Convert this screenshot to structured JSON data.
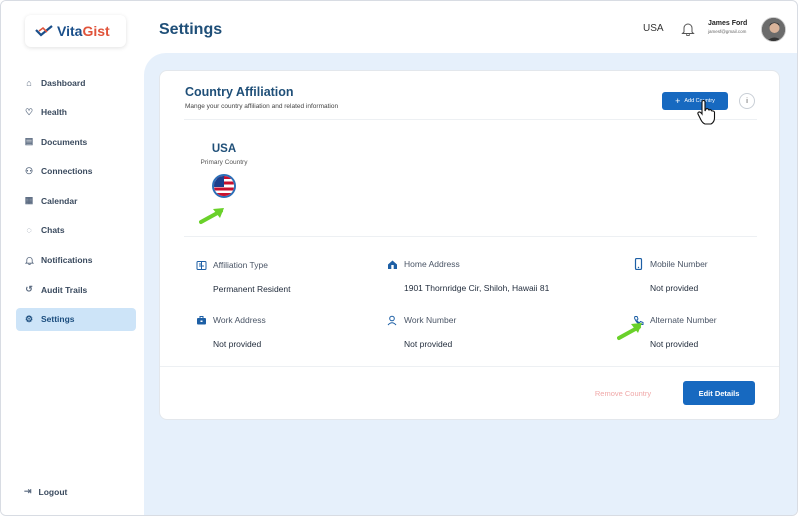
{
  "brand": {
    "name_part1": "Vita",
    "name_part2": "Gist"
  },
  "header": {
    "title": "Settings",
    "country": "USA",
    "user_name": "James Ford",
    "user_email": "jamesf@gmail.com"
  },
  "sidebar": {
    "items": [
      {
        "label": "Dashboard",
        "icon": "home-icon",
        "glyph": "⌂"
      },
      {
        "label": "Health",
        "icon": "heart-icon",
        "glyph": "♡"
      },
      {
        "label": "Documents",
        "icon": "document-icon",
        "glyph": "▤"
      },
      {
        "label": "Connections",
        "icon": "people-icon",
        "glyph": "⚇"
      },
      {
        "label": "Calendar",
        "icon": "calendar-icon",
        "glyph": "▦"
      },
      {
        "label": "Chats",
        "icon": "chat-icon",
        "glyph": "◌"
      },
      {
        "label": "Notifications",
        "icon": "bell-icon",
        "glyph": "🔔︎"
      },
      {
        "label": "Audit Trails",
        "icon": "history-icon",
        "glyph": "↺"
      },
      {
        "label": "Settings",
        "icon": "gear-icon",
        "glyph": "⚙"
      }
    ],
    "active_index": 8,
    "logout_label": "Logout"
  },
  "card": {
    "title": "Country Affiliation",
    "subtitle": "Mange your country affiliation and related information",
    "add_button": "Add Country",
    "country_name": "USA",
    "country_role": "Primary Country",
    "fields": {
      "affiliation_type": {
        "label": "Affiliation Type",
        "value": "Permanent Resident"
      },
      "home_address": {
        "label": "Home Address",
        "value": "1901 Thornridge Cir, Shiloh, Hawaii 81"
      },
      "mobile_number": {
        "label": "Mobile Number",
        "value": "Not provided"
      },
      "work_address": {
        "label": "Work Address",
        "value": "Not provided"
      },
      "work_number": {
        "label": "Work Number",
        "value": "Not provided"
      },
      "alternate_number": {
        "label": "Alternate Number",
        "value": "Not provided"
      }
    },
    "remove_button": "Remove Country",
    "edit_button": "Edit Details"
  },
  "colors": {
    "primary": "#1769c0",
    "title": "#1f4f78",
    "active_nav": "#cde4f8",
    "main_bg": "#e6f0fb",
    "annotation_arrow": "#6ad12a"
  }
}
